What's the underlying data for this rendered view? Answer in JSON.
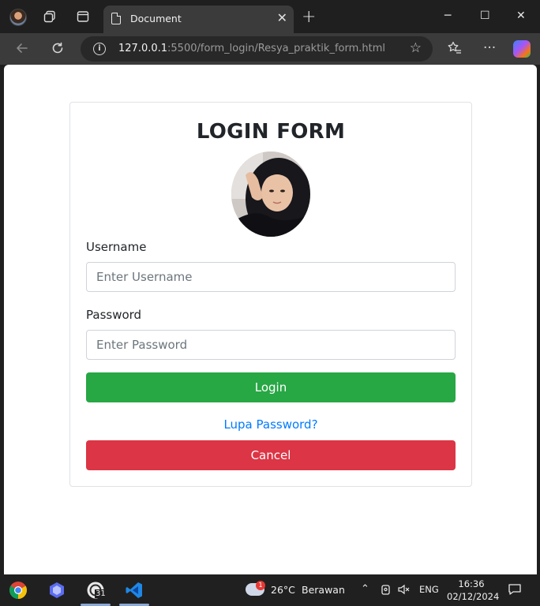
{
  "browser": {
    "tab": {
      "title": "Document",
      "close": "✕"
    },
    "new_tab": "+",
    "window_controls": {
      "minimize": "─",
      "maximize": "☐",
      "close": "✕"
    },
    "address": {
      "host": "127.0.0.1",
      "path": ":5500/form_login/Resya_praktik_form.html"
    },
    "icons": [
      "profile-avatar-icon",
      "workspaces-icon",
      "tab-actions-icon",
      "back-icon",
      "refresh-icon",
      "site-info-icon",
      "favorite-star-icon",
      "favorites-icon",
      "more-icon",
      "copilot-icon"
    ]
  },
  "form": {
    "title": "LOGIN FORM",
    "username": {
      "label": "Username",
      "placeholder": "Enter Username",
      "value": ""
    },
    "password": {
      "label": "Password",
      "placeholder": "Enter Password",
      "value": ""
    },
    "login_button": "Login",
    "forgot_link": "Lupa Password?",
    "cancel_button": "Cancel"
  },
  "taskbar": {
    "apps": [
      "chrome-icon",
      "copilot-app-icon",
      "whatsapp-icon",
      "vscode-icon"
    ],
    "whatsapp_badge": "31",
    "weather": {
      "badge": "1",
      "temperature": "26°C",
      "condition": "Berawan"
    },
    "language": "ENG",
    "time": "16:36",
    "date": "02/12/2024"
  },
  "colors": {
    "login": "#28a745",
    "cancel": "#dc3545",
    "link": "#007bff"
  }
}
